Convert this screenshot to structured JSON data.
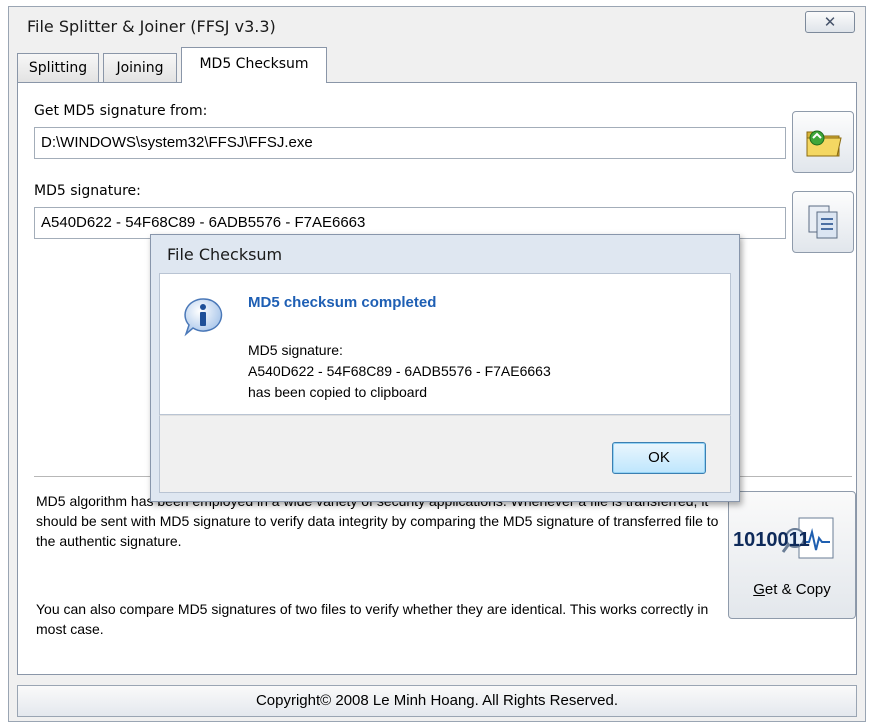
{
  "window": {
    "title": "File Splitter & Joiner (FFSJ v3.3)",
    "close_glyph": "✕"
  },
  "tabs": [
    {
      "label": "Splitting",
      "active": false
    },
    {
      "label": "Joining",
      "active": false
    },
    {
      "label": "MD5 Checksum",
      "active": true
    }
  ],
  "md5": {
    "source_label": "Get MD5 signature from:",
    "source_value": "D:\\WINDOWS\\system32\\FFSJ\\FFSJ.exe",
    "signature_label": "MD5 signature:",
    "signature_value": "A540D622 - 54F68C89 - 6ADB5576 - F7AE6663",
    "browse_icon": "folder-icon",
    "copy_icon": "copy-icon"
  },
  "description": {
    "para1": "MD5 algorithm has been employed in a wide variety of security applications. Whenever a file is transferred, it should be sent with MD5 signature to verify data integrity by comparing the MD5 signature of transferred file to the authentic signature.",
    "para2": "You can also compare MD5 signatures of two files to verify whether they are identical. This works correctly in most case."
  },
  "get_copy_button": {
    "label_underlined": "G",
    "label_rest": "et & Copy",
    "icon_text": "1010011"
  },
  "statusbar": {
    "text": "Copyright© 2008 Le Minh Hoang. All Rights Reserved."
  },
  "dialog": {
    "title": "File Checksum",
    "heading": "MD5 checksum completed",
    "line1": "MD5 signature:",
    "line2": "A540D622 - 54F68C89 - 6ADB5576 - F7AE6663",
    "line3": "has been copied to clipboard",
    "ok_label": "OK",
    "icon": "info-icon",
    "accent_color": "#1e5fb4"
  }
}
